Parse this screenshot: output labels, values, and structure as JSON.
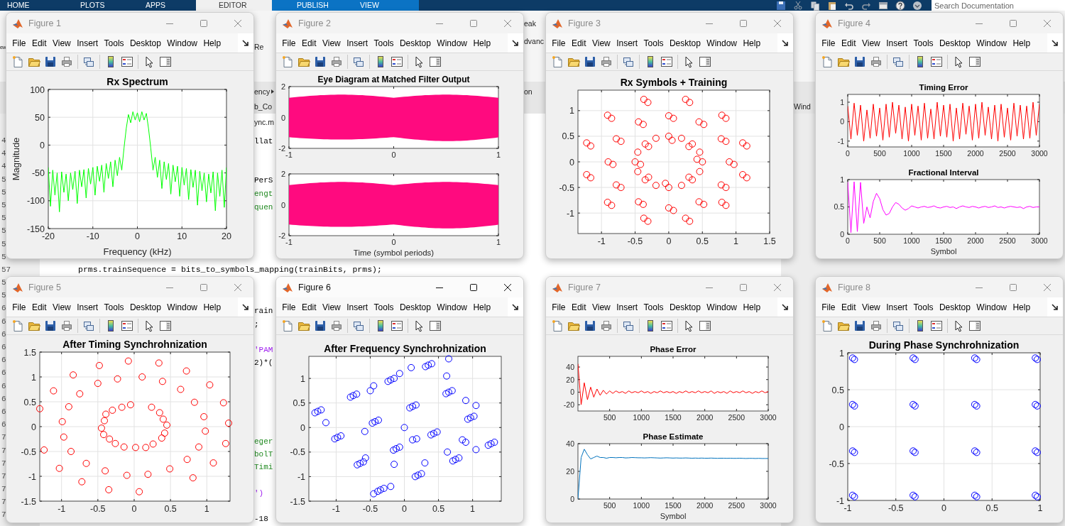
{
  "toolstrip": {
    "tabs": [
      {
        "label": "HOME",
        "selected": false,
        "highlighted": false
      },
      {
        "label": "PLOTS",
        "selected": false,
        "highlighted": false
      },
      {
        "label": "APPS",
        "selected": false,
        "highlighted": false
      },
      {
        "label": "EDITOR",
        "selected": true,
        "highlighted": false
      },
      {
        "label": "PUBLISH",
        "selected": false,
        "highlighted": true
      },
      {
        "label": "VIEW",
        "selected": false,
        "highlighted": true
      }
    ],
    "search": {
      "placeholder": "Search Documentation"
    }
  },
  "background": {
    "columns": [
      [
        {
          "text": "ew",
          "kind": "ui"
        },
        {
          "text": "4",
          "kind": "number"
        },
        {
          "text": "4",
          "kind": "number"
        },
        {
          "text": "4",
          "kind": "number"
        },
        {
          "text": "5",
          "kind": "number"
        },
        {
          "text": "5",
          "kind": "number"
        },
        {
          "text": "5",
          "kind": "number"
        },
        {
          "text": "5",
          "kind": "number"
        },
        {
          "text": "5",
          "kind": "number"
        },
        {
          "text": "5",
          "kind": "number"
        },
        {
          "text": "5",
          "kind": "number"
        },
        {
          "text": "57",
          "kind": "number"
        },
        {
          "text": "5",
          "kind": "number"
        },
        {
          "text": "5",
          "kind": "number"
        },
        {
          "text": "6",
          "kind": "number"
        },
        {
          "text": "6",
          "kind": "number"
        },
        {
          "text": "6",
          "kind": "number"
        },
        {
          "text": "6",
          "kind": "number"
        },
        {
          "text": "6",
          "kind": "number"
        },
        {
          "text": "6",
          "kind": "number"
        },
        {
          "text": "6",
          "kind": "number"
        },
        {
          "text": "6",
          "kind": "number"
        },
        {
          "text": "6",
          "kind": "number"
        },
        {
          "text": "6",
          "kind": "number"
        },
        {
          "text": "7",
          "kind": "number"
        },
        {
          "text": "7",
          "kind": "number"
        },
        {
          "text": "7",
          "kind": "number"
        },
        {
          "text": "7",
          "kind": "number"
        },
        {
          "text": "7",
          "kind": "number"
        },
        {
          "text": "7",
          "kind": "number"
        },
        {
          "text": "7",
          "kind": "number"
        }
      ],
      [
        {
          "text": "Re",
          "kind": "ui"
        },
        {
          "text": "ency",
          "kind": "crumb"
        },
        {
          "text": "b_Co",
          "kind": "ui"
        },
        {
          "text": "ync.m",
          "kind": "ui"
        },
        {
          "text": "llat",
          "kind": "code"
        },
        {
          "text": "PerS",
          "kind": "code"
        },
        {
          "text": "engt",
          "kind": "comment"
        },
        {
          "text": "quen",
          "kind": "comment"
        },
        {
          "text": "rain",
          "kind": "code"
        },
        {
          "text": ";",
          "kind": "code"
        },
        {
          "text": "'PAM",
          "kind": "string"
        },
        {
          "text": "2)*(",
          "kind": "code"
        },
        {
          "text": "eger",
          "kind": "comment"
        },
        {
          "text": "bolT",
          "kind": "comment"
        },
        {
          "text": "Timi",
          "kind": "comment"
        },
        {
          "text": "')",
          "kind": "string"
        },
        {
          "text": "-18",
          "kind": "code"
        }
      ],
      [
        {
          "text": "eak",
          "kind": "ui"
        },
        {
          "text": "dvanc",
          "kind": "ui"
        },
        {
          "text": "on",
          "kind": "ui"
        }
      ],
      [
        {
          "text": "Wind",
          "kind": "ui"
        }
      ]
    ],
    "code_line": "prms.trainSequence = bits_to_symbols_mapping(trainBits, prms);"
  },
  "figures": [
    {
      "title": "Figure 1",
      "active": false,
      "menu": [
        "File",
        "Edit",
        "View",
        "Insert",
        "Tools",
        "Desktop",
        "Window",
        "Help"
      ],
      "axes": [
        {
          "kind": "chart",
          "chart_data": {
            "grid": true,
            "type": "line",
            "title": "Rx Spectrum",
            "xlabel": "Frequency (kHz)",
            "ylabel": "Magnitude",
            "xlim": [
              -20,
              20
            ],
            "ylim": [
              -150,
              100
            ],
            "xticks": [
              -20,
              -10,
              0,
              10,
              20
            ],
            "yticks": [
              -150,
              -100,
              -50,
              0,
              50,
              100
            ],
            "x": [
              -20,
              -19.5,
              -19,
              -18.5,
              -18,
              -17.5,
              -17,
              -16.5,
              -16,
              -15.5,
              -15,
              -14.5,
              -14,
              -13.5,
              -13,
              -12.5,
              -12,
              -11.5,
              -11,
              -10.5,
              -10,
              -9.5,
              -9,
              -8.5,
              -8,
              -7.5,
              -7,
              -6.5,
              -6,
              -5.5,
              -5,
              -4.5,
              -4,
              -3.5,
              -3,
              -2.5,
              -2,
              -1.5,
              -1,
              -0.5,
              0,
              0.5,
              1,
              1.5,
              2,
              2.5,
              3,
              3.5,
              4,
              4.5,
              5,
              5.5,
              6,
              6.5,
              7,
              7.5,
              8,
              8.5,
              9,
              9.5,
              10,
              10.5,
              11,
              11.5,
              12,
              12.5,
              13,
              13.5,
              14,
              14.5,
              15,
              15.5,
              16,
              16.5,
              17,
              17.5,
              18,
              18.5,
              19,
              19.5,
              20
            ],
            "series": [
              {
                "color": "#00ff00",
                "values": [
                  -40,
                  -110,
                  -45,
                  -90,
                  -50,
                  -120,
                  -48,
                  -85,
                  -52,
                  -100,
                  -50,
                  -80,
                  -47,
                  -105,
                  -45,
                  -75,
                  -44,
                  -95,
                  -42,
                  -70,
                  -40,
                  -90,
                  -38,
                  -65,
                  -36,
                  -85,
                  -33,
                  -60,
                  -30,
                  -75,
                  -27,
                  -55,
                  -22,
                  -45,
                  -5,
                  30,
                  55,
                  40,
                  60,
                  45,
                  58,
                  42,
                  60,
                  45,
                  57,
                  30,
                  -5,
                  -45,
                  -22,
                  -58,
                  -27,
                  -78,
                  -30,
                  -62,
                  -33,
                  -88,
                  -36,
                  -66,
                  -38,
                  -92,
                  -40,
                  -72,
                  -42,
                  -98,
                  -44,
                  -76,
                  -45,
                  -108,
                  -47,
                  -82,
                  -50,
                  -102,
                  -52,
                  -86,
                  -48,
                  -118,
                  -50,
                  -92,
                  -45,
                  -112,
                  -40
                ]
              }
            ]
          }
        }
      ]
    },
    {
      "title": "Figure 2",
      "active": false,
      "menu": [
        "File",
        "Edit",
        "View",
        "Insert",
        "Tools",
        "Desktop",
        "Window",
        "Help"
      ],
      "axes": [
        {
          "kind": "eye",
          "title": "Eye Diagram at Matched Filter Output",
          "xtick_labels": [
            "-1",
            "0",
            "1"
          ],
          "ytick_labels": [
            "2",
            "0",
            "-2"
          ]
        },
        {
          "kind": "eye",
          "xlabel": "Time (symbol periods)",
          "xtick_labels": [
            "-1",
            "0",
            "1"
          ],
          "ytick_labels": [
            "2",
            "0",
            "-2"
          ]
        }
      ]
    },
    {
      "title": "Figure 3",
      "active": false,
      "menu": [
        "File",
        "Edit",
        "View",
        "Insert",
        "Tools",
        "Desktop",
        "Window",
        "Help"
      ],
      "axes": [
        {
          "kind": "chart",
          "chart_data": {
            "grid": true,
            "type": "scatter",
            "title": "Rx Symbols + Training",
            "xlim": [
              -1.35,
              1.5
            ],
            "ylim": [
              -1.4,
              1.4
            ],
            "xticks": [
              -1,
              -0.5,
              0,
              0.5,
              1,
              1.5
            ],
            "yticks": [
              -1,
              -0.5,
              0,
              0.5,
              1
            ],
            "series": [
              {
                "color": "#ff0000",
                "x": [
                  0.5,
                  0.46,
                  0.35,
                  0.19,
                  0,
                  -0.19,
                  -0.35,
                  -0.46,
                  -0.5,
                  -0.46,
                  -0.35,
                  -0.19,
                  0,
                  0.19,
                  0.35,
                  0.46,
                  0.42,
                  0.3,
                  0.05,
                  -0.3,
                  -0.42,
                  -0.3,
                  -0.05,
                  0.3,
                  0.9,
                  0.78,
                  0.45,
                  0,
                  -0.45,
                  -0.78,
                  -0.9,
                  -0.78,
                  -0.45,
                  0,
                  0.45,
                  0.78,
                  0.97,
                  0.85,
                  0.52,
                  0.07,
                  -0.38,
                  -0.71,
                  -0.83,
                  -0.71,
                  -0.38,
                  0.07,
                  0.52,
                  0.85,
                  1.16,
                  0.85,
                  0.31,
                  -0.31,
                  -0.85,
                  -1.16,
                  -1.16,
                  -0.85,
                  -0.31,
                  0.31,
                  0.85,
                  1.16,
                  1.1,
                  0.79,
                  0.25,
                  -0.37,
                  -0.91,
                  -1.22,
                  -1.22,
                  -0.91,
                  -0.37,
                  0.25,
                  0.79,
                  1.1
                ],
                "values": [
                  0,
                  0.19,
                  0.35,
                  0.46,
                  0.5,
                  0.46,
                  0.35,
                  0.19,
                  0,
                  -0.19,
                  -0.35,
                  -0.46,
                  -0.5,
                  -0.46,
                  -0.35,
                  -0.19,
                  0.05,
                  0.3,
                  0.42,
                  0.3,
                  -0.05,
                  -0.3,
                  -0.42,
                  -0.3,
                  0,
                  0.45,
                  0.78,
                  0.9,
                  0.78,
                  0.45,
                  0,
                  -0.45,
                  -0.78,
                  -0.9,
                  -0.78,
                  -0.45,
                  -0.05,
                  0.4,
                  0.73,
                  0.85,
                  0.73,
                  0.4,
                  -0.05,
                  -0.5,
                  -0.83,
                  -0.95,
                  -0.83,
                  -0.5,
                  0.31,
                  0.85,
                  1.16,
                  1.16,
                  0.85,
                  0.31,
                  -0.31,
                  -0.85,
                  -1.16,
                  -1.16,
                  -0.85,
                  -0.31,
                  0.37,
                  0.91,
                  1.22,
                  1.22,
                  0.91,
                  0.37,
                  -0.25,
                  -0.79,
                  -1.1,
                  -1.1,
                  -0.79,
                  -0.25
                ]
              }
            ]
          }
        }
      ]
    },
    {
      "title": "Figure 4",
      "active": false,
      "menu": [
        "File",
        "Edit",
        "View",
        "Insert",
        "Tools",
        "Desktop",
        "Window",
        "Help"
      ],
      "axes": [
        {
          "kind": "chart",
          "chart_data": {
            "type": "line",
            "title": "Timing Error",
            "xlim": [
              0,
              3000
            ],
            "ylim": [
              -1.3,
              1.4
            ],
            "xticks": [
              0,
              500,
              1000,
              1500,
              2000,
              2500,
              3000
            ],
            "yticks": [
              -1,
              0,
              1
            ],
            "x": [
              0,
              50,
              100,
              150,
              200,
              250,
              300,
              350,
              400,
              450,
              500,
              550,
              600,
              650,
              700,
              750,
              800,
              850,
              900,
              950,
              1000,
              1050,
              1100,
              1150,
              1200,
              1250,
              1300,
              1350,
              1400,
              1450,
              1500,
              1550,
              1600,
              1650,
              1700,
              1750,
              1800,
              1850,
              1900,
              1950,
              2000,
              2050,
              2100,
              2150,
              2200,
              2250,
              2300,
              2350,
              2400,
              2450,
              2500,
              2550,
              2600,
              2650,
              2700,
              2750,
              2800,
              2850,
              2900,
              2950,
              3000
            ],
            "series": [
              {
                "color": "#ff0000",
                "values": [
                  0.8,
                  -0.9,
                  0.95,
                  -0.7,
                  0.85,
                  -1,
                  0.6,
                  -0.85,
                  0.9,
                  -0.75,
                  0.7,
                  -0.95,
                  0.9,
                  -0.8,
                  1,
                  -0.6,
                  0.85,
                  -0.9,
                  0.75,
                  -1,
                  0.9,
                  -0.7,
                  0.8,
                  -0.95,
                  0.95,
                  -0.85,
                  0.65,
                  -0.9,
                  1,
                  -0.75,
                  0.85,
                  -0.8,
                  0.9,
                  -1,
                  0.7,
                  -0.9,
                  0.95,
                  -0.65,
                  0.8,
                  -0.95,
                  0.9,
                  -0.85,
                  1,
                  -0.7,
                  0.75,
                  -0.9,
                  0.85,
                  -1,
                  0.9,
                  -0.8,
                  0.7,
                  -0.95,
                  0.95,
                  -0.75,
                  0.85,
                  -0.9,
                  0.8,
                  -0.85,
                  1,
                  -0.7,
                  0.9
                ]
              }
            ]
          }
        },
        {
          "kind": "chart",
          "chart_data": {
            "type": "line",
            "title": "Fractional Interval",
            "xlabel": "Symbol",
            "xlim": [
              0,
              3000
            ],
            "ylim": [
              0,
              1
            ],
            "xticks": [
              0,
              500,
              1000,
              1500,
              2000,
              2500,
              3000
            ],
            "yticks": [
              0,
              0.5,
              1
            ],
            "x": [
              0,
              50,
              100,
              150,
              200,
              250,
              300,
              350,
              400,
              450,
              500,
              550,
              600,
              650,
              700,
              750,
              800,
              850,
              900,
              950,
              1000,
              1050,
              1100,
              1150,
              1200,
              1250,
              1300,
              1350,
              1400,
              1450,
              1500,
              1550,
              1600,
              1650,
              1700,
              1750,
              1800,
              1850,
              1900,
              1950,
              2000,
              2050,
              2100,
              2150,
              2200,
              2250,
              2300,
              2350,
              2400,
              2450,
              2500,
              2550,
              2600,
              2650,
              2700,
              2750,
              2800,
              2850,
              2900,
              2950,
              3000
            ],
            "series": [
              {
                "color": "#ff00ff",
                "values": [
                  0.96,
                  0.03,
                  0.96,
                  0.05,
                  0.95,
                  0.2,
                  0.5,
                  0.3,
                  0.6,
                  0.75,
                  0.65,
                  0.45,
                  0.35,
                  0.38,
                  0.5,
                  0.58,
                  0.55,
                  0.48,
                  0.44,
                  0.47,
                  0.52,
                  0.5,
                  0.48,
                  0.5,
                  0.51,
                  0.49,
                  0.5,
                  0.52,
                  0.49,
                  0.48,
                  0.5,
                  0.51,
                  0.49,
                  0.5,
                  0.47,
                  0.5,
                  0.52,
                  0.5,
                  0.49,
                  0.51,
                  0.5,
                  0.48,
                  0.5,
                  0.51,
                  0.49,
                  0.5,
                  0.52,
                  0.49,
                  0.5,
                  0.48,
                  0.5,
                  0.51,
                  0.5,
                  0.49,
                  0.5,
                  0.47,
                  0.5,
                  0.51,
                  0.49,
                  0.5,
                  0.5
                ]
              }
            ]
          }
        }
      ]
    },
    {
      "title": "Figure 5",
      "active": false,
      "menu": [
        "File",
        "Edit",
        "View",
        "Insert",
        "Tools",
        "Desktop",
        "Window",
        "Help"
      ],
      "axes": [
        {
          "kind": "chart",
          "chart_data": {
            "grid": true,
            "type": "scatter",
            "title": "After Timing Synchrohnization",
            "xlim": [
              -1.3,
              1.32
            ],
            "ylim": [
              -1.5,
              1.5
            ],
            "xticks": [
              -1,
              -0.5,
              0,
              0.5,
              1
            ],
            "yticks": [
              -1.5,
              -1,
              -0.5,
              0,
              0.5,
              1,
              1.5
            ],
            "series": [
              {
                "color": "#ff0000",
                "x": [
                  -1.3,
                  -1.11,
                  -0.84,
                  -0.48,
                  -0.08,
                  0.34,
                  0.72,
                  1.04,
                  1.23,
                  1.3,
                  1.26,
                  1.09,
                  0.81,
                  0.49,
                  0.19,
                  0.07,
                  -0.1,
                  -0.35,
                  -0.4,
                  -0.72,
                  -0.66,
                  -1.03,
                  -1.24,
                  -0.87,
                  -0.97,
                  -0.99,
                  -0.9,
                  -0.75,
                  -0.5,
                  -0.23,
                  0.11,
                  0.39,
                  0.64,
                  0.83,
                  0.96,
                  0.98,
                  0.89,
                  0.73,
                  -0.17,
                  -0.05,
                  0.24,
                  0.35,
                  0.4,
                  0.45,
                  0.42,
                  0.38,
                  0.26,
                  0.16,
                  0.02,
                  -0.14,
                  -0.26,
                  -0.34,
                  -0.42,
                  -0.45,
                  -0.41,
                  -0.39,
                  -0.3
                ],
                "values": [
                  0.36,
                  0.72,
                  1.04,
                  1.23,
                  1.32,
                  1.28,
                  1.12,
                  0.84,
                  0.48,
                  0.07,
                  -0.34,
                  -0.73,
                  -1.03,
                  -0.85,
                  -0.96,
                  -1.31,
                  -0.98,
                  -1.27,
                  -0.89,
                  -1.11,
                  -0.74,
                  -0.84,
                  -0.47,
                  -0.5,
                  -0.21,
                  0.1,
                  0.4,
                  0.66,
                  0.87,
                  0.96,
                  1,
                  0.91,
                  0.75,
                  0.49,
                  0.2,
                  -0.09,
                  -0.41,
                  -0.66,
                  0.39,
                  0.44,
                  0.39,
                  0.28,
                  0.15,
                  0.03,
                  -0.13,
                  -0.23,
                  -0.35,
                  -0.42,
                  -0.42,
                  -0.41,
                  -0.34,
                  -0.25,
                  -0.16,
                  -0.03,
                  0.12,
                  0.25,
                  0.33
                ]
              }
            ]
          }
        }
      ]
    },
    {
      "title": "Figure 6",
      "active": true,
      "menu": [
        "File",
        "Edit",
        "View",
        "Insert",
        "Tools",
        "Desktop",
        "Window",
        "Help"
      ],
      "axes": [
        {
          "kind": "chart",
          "chart_data": {
            "grid": true,
            "type": "scatter",
            "title": "After Frequency Synchrohnization",
            "xlim": [
              -1.4,
              1.42
            ],
            "ylim": [
              -1.5,
              1.45
            ],
            "xticks": [
              -1,
              -0.5,
              0,
              0.5,
              1
            ],
            "yticks": [
              -1.5,
              -1,
              -0.5,
              0,
              0.5,
              1
            ],
            "series": [
              {
                "color": "#0000ff",
                "x": [
                  -1.27,
                  -1.22,
                  -1.31,
                  -0.98,
                  -0.93,
                  -1.02,
                  -0.75,
                  -0.7,
                  -0.79,
                  -0.2,
                  -0.15,
                  -0.24,
                  0.35,
                  0.4,
                  0.31,
                  0.65,
                  0.7,
                  0.61,
                  0.97,
                  1.02,
                  0.93,
                  1.27,
                  1.32,
                  1.23,
                  0.75,
                  0.8,
                  0.71,
                  0.2,
                  0.25,
                  0.16,
                  -0.35,
                  -0.3,
                  -0.39,
                  -0.65,
                  -0.6,
                  -0.69,
                  -0.43,
                  -0.38,
                  -0.47,
                  0.12,
                  0.17,
                  0.08,
                  0.43,
                  0.48,
                  0.39,
                  -0.12,
                  -0.07,
                  -0.16,
                  -1.15,
                  -0.5,
                  -0.45,
                  -0.07,
                  0.1,
                  0.62,
                  0.65,
                  0.9,
                  0.85,
                  0.9,
                  1.05,
                  0.63,
                  0.3,
                  0.18,
                  0,
                  -0.57,
                  -0.15,
                  -0.45,
                  -0.2,
                  0.12,
                  -0.58,
                  1.05
                ],
                "values": [
                  0.33,
                  0.36,
                  0.3,
                  -0.2,
                  -0.17,
                  -0.23,
                  0.65,
                  0.68,
                  0.62,
                  0.97,
                  1,
                  0.94,
                  1.27,
                  1.3,
                  1.24,
                  0.72,
                  0.75,
                  0.69,
                  0.2,
                  0.23,
                  0.17,
                  -0.33,
                  -0.3,
                  -0.36,
                  -0.65,
                  -0.62,
                  -0.68,
                  -0.97,
                  -0.94,
                  -1,
                  -1.27,
                  -1.24,
                  -1.3,
                  -0.73,
                  -0.7,
                  -0.76,
                  0.12,
                  0.15,
                  0.09,
                  0.43,
                  0.46,
                  0.4,
                  -0.12,
                  -0.09,
                  -0.15,
                  -0.43,
                  -0.4,
                  -0.46,
                  0.1,
                  0.75,
                  0.85,
                  1.1,
                  1.22,
                  1.05,
                  1.4,
                  0.55,
                  -0.25,
                  -0.3,
                  -0.45,
                  -0.5,
                  -0.72,
                  -0.23,
                  0,
                  -0.62,
                  -0.75,
                  -1.35,
                  -1.2,
                  -0.25,
                  -0.08,
                  0.45
                ]
              }
            ]
          }
        }
      ]
    },
    {
      "title": "Figure 7",
      "active": false,
      "menu": [
        "File",
        "Edit",
        "View",
        "Insert",
        "Tools",
        "Desktop",
        "Window",
        "Help"
      ],
      "axes": [
        {
          "kind": "chart",
          "chart_data": {
            "type": "line",
            "title": "Phase Error",
            "xlim": [
              0,
              3000
            ],
            "ylim": [
              -30,
              57
            ],
            "xticks": [
              500,
              1000,
              1500,
              2000,
              2500,
              3000
            ],
            "yticks": [
              -20,
              0,
              20,
              40
            ],
            "x": [
              0,
              50,
              100,
              150,
              200,
              250,
              300,
              350,
              400,
              450,
              500,
              550,
              600,
              650,
              700,
              750,
              800,
              850,
              900,
              950,
              1000,
              1050,
              1100,
              1150,
              1200,
              1250,
              1300,
              1350,
              1400,
              1450,
              1500,
              1550,
              1600,
              1650,
              1700,
              1750,
              1800,
              1850,
              1900,
              1950,
              2000,
              2050,
              2100,
              2150,
              2200,
              2250,
              2300,
              2350,
              2400,
              2450,
              2500,
              2550,
              2600,
              2650,
              2700,
              2750,
              2800,
              2850,
              2900,
              2950,
              3000
            ],
            "series": [
              {
                "color": "#ff0000",
                "values": [
                  45,
                  -20,
                  15,
                  -12,
                  8,
                  -8,
                  5,
                  -5,
                  3,
                  -3,
                  2,
                  -2,
                  2,
                  -1,
                  1,
                  -2,
                  2,
                  -1,
                  1,
                  -1,
                  2,
                  -1,
                  1,
                  -2,
                  1,
                  -1,
                  2,
                  -1,
                  1,
                  -1,
                  1,
                  -2,
                  1,
                  -1,
                  2,
                  -1,
                  1,
                  -1,
                  2,
                  -1,
                  1,
                  -1,
                  2,
                  -2,
                  1,
                  -1,
                  1,
                  -2,
                  2,
                  -1,
                  1,
                  -1,
                  2,
                  -1,
                  1,
                  -2,
                  1,
                  -1,
                  2,
                  -1,
                  1
                ]
              }
            ]
          }
        },
        {
          "kind": "chart",
          "chart_data": {
            "type": "line",
            "title": "Phase Estimate",
            "xlabel": "Symbol",
            "xlim": [
              0,
              3000
            ],
            "ylim": [
              0,
              40
            ],
            "xticks": [
              500,
              1000,
              1500,
              2000,
              2500,
              3000
            ],
            "yticks": [
              0,
              20,
              40
            ],
            "x": [
              0,
              50,
              100,
              150,
              200,
              250,
              300,
              350,
              400,
              450,
              500,
              550,
              600,
              650,
              700,
              750,
              800,
              850,
              900,
              950,
              1000,
              1050,
              1100,
              1150,
              1200,
              1250,
              1300,
              1350,
              1400,
              1450,
              1500,
              1550,
              1600,
              1650,
              1700,
              1750,
              1800,
              1850,
              1900,
              1950,
              2000,
              2050,
              2100,
              2150,
              2200,
              2250,
              2300,
              2350,
              2400,
              2450,
              2500,
              2550,
              2600,
              2650,
              2700,
              2750,
              2800,
              2850,
              2900,
              2950,
              3000
            ],
            "series": [
              {
                "color": "#0072bd",
                "values": [
                  0,
                  30,
                  36,
                  32,
                  29,
                  30,
                  31,
                  30,
                  30,
                  29.5,
                  30,
                  30,
                  29.8,
                  30,
                  30,
                  29.7,
                  29.8,
                  30,
                  29.9,
                  29.8,
                  29.8,
                  29.7,
                  29.8,
                  29.9,
                  29.8,
                  29.7,
                  29.6,
                  29.7,
                  29.8,
                  29.7,
                  29.6,
                  29.7,
                  29.6,
                  29.6,
                  29.7,
                  29.6,
                  29.5,
                  29.6,
                  29.5,
                  29.6,
                  29.5,
                  29.5,
                  29.6,
                  29.5,
                  29.4,
                  29.5,
                  29.5,
                  29.4,
                  29.5,
                  29.4,
                  29.4,
                  29.5,
                  29.4,
                  29.3,
                  29.4,
                  29.4,
                  29.3,
                  29.4,
                  29.3,
                  29.3,
                  29.3
                ]
              }
            ]
          }
        }
      ]
    },
    {
      "title": "Figure 8",
      "active": false,
      "menu": [
        "File",
        "Edit",
        "View",
        "Insert",
        "Tools",
        "Desktop",
        "Window",
        "Help"
      ],
      "axes": [
        {
          "kind": "chart",
          "chart_data": {
            "grid": true,
            "type": "scatter",
            "title": "During Phase Synchrohnization",
            "xlim": [
              -1,
              1
            ],
            "ylim": [
              -1,
              1
            ],
            "xticks": [
              -1,
              -0.5,
              0,
              0.5,
              1
            ],
            "yticks": [
              -1,
              -0.5,
              0,
              0.5,
              1
            ],
            "series": [
              {
                "color": "#0000ff",
                "x": [
                  -0.95,
                  -0.93,
                  -0.32,
                  -0.3,
                  0.32,
                  0.34,
                  0.95,
                  0.97,
                  -0.95,
                  -0.93,
                  -0.32,
                  -0.3,
                  0.32,
                  0.34,
                  0.95,
                  0.97,
                  -0.95,
                  -0.93,
                  -0.32,
                  -0.3,
                  0.32,
                  0.34,
                  0.95,
                  0.97,
                  -0.95,
                  -0.93,
                  -0.32,
                  -0.3,
                  0.32,
                  0.34,
                  0.95,
                  0.97
                ],
                "values": [
                  0.93,
                  0.91,
                  0.93,
                  0.91,
                  0.93,
                  0.91,
                  0.93,
                  0.91,
                  0.3,
                  0.28,
                  0.3,
                  0.28,
                  0.3,
                  0.28,
                  0.3,
                  0.28,
                  -0.33,
                  -0.35,
                  -0.33,
                  -0.35,
                  -0.33,
                  -0.35,
                  -0.33,
                  -0.35,
                  -0.93,
                  -0.95,
                  -0.93,
                  -0.95,
                  -0.93,
                  -0.95,
                  -0.93,
                  -0.95
                ]
              }
            ]
          }
        }
      ]
    }
  ]
}
